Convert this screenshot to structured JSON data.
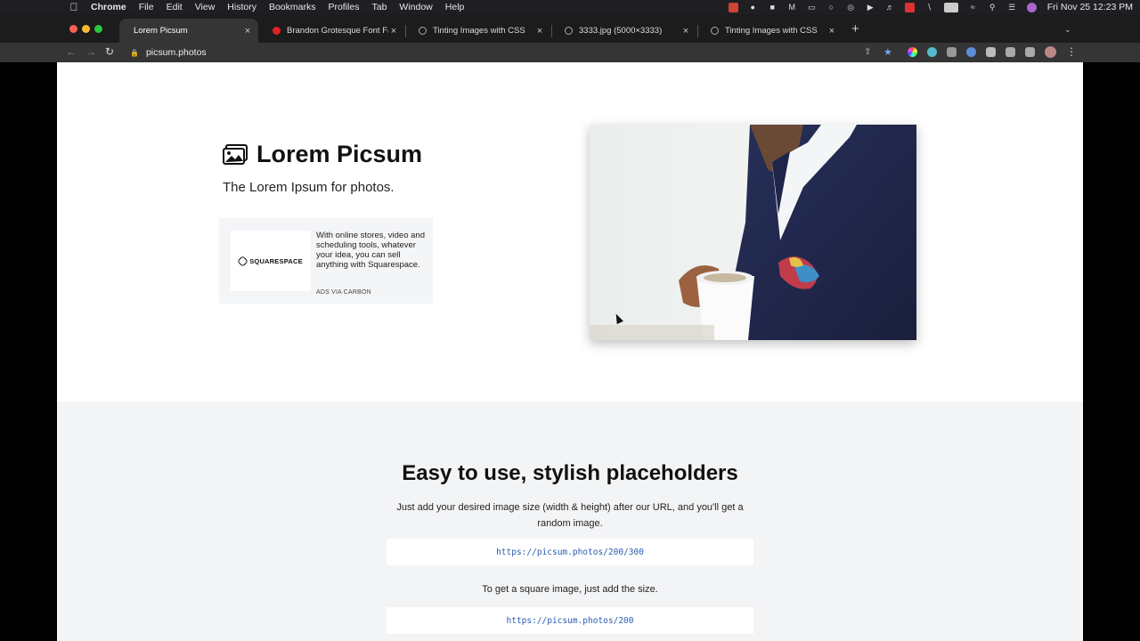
{
  "menubar": {
    "app": "Chrome",
    "menus": [
      "File",
      "Edit",
      "View",
      "History",
      "Bookmarks",
      "Profiles",
      "Tab",
      "Window",
      "Help"
    ],
    "clock": "Fri Nov 25  12:23 PM"
  },
  "tabs": [
    {
      "title": "Lorem Picsum",
      "active": true
    },
    {
      "title": "Brandon Grotesque Font Famil",
      "active": false
    },
    {
      "title": "Tinting Images with CSS",
      "active": false
    },
    {
      "title": "3333.jpg (5000×3333)",
      "active": false
    },
    {
      "title": "Tinting Images with CSS",
      "active": false
    }
  ],
  "omnibox": {
    "url": "picsum.photos"
  },
  "page": {
    "title": "Lorem Picsum",
    "tagline": "The Lorem Ipsum for photos.",
    "ad": {
      "brand": "SQUARESPACE",
      "text": "With online stores, video and scheduling tools, whatever your idea, you can sell anything with Squarespace.",
      "via": "ADS VIA CARBON"
    },
    "section": {
      "heading": "Easy to use, stylish placeholders",
      "description": "Just add your desired image size (width & height) after our URL, and you'll get a random image.",
      "example_url_1": "https://picsum.photos/200/300",
      "description_2": "To get a square image, just add the size.",
      "example_url_2": "https://picsum.photos/200"
    }
  },
  "colors": {
    "accent_link": "#2a5db0",
    "section_bg": "#f3f4f6",
    "chrome_dark": "#1c1c1c"
  }
}
